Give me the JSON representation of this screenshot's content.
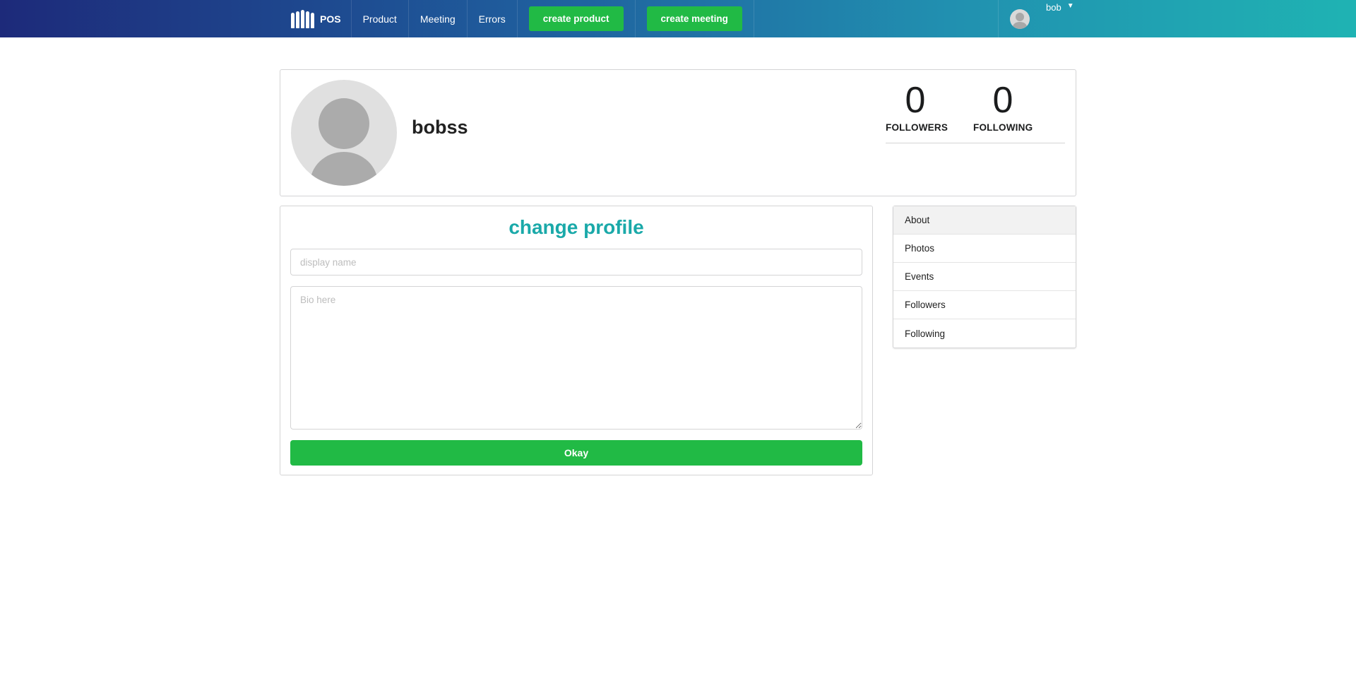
{
  "colors": {
    "accent_teal": "#1aa9a9",
    "button_green": "#21ba45",
    "nav_gradient_start": "#1d2a7a",
    "nav_gradient_end": "#1fb3b3"
  },
  "nav": {
    "brand": "POS",
    "brand_icon": "people-group-icon",
    "links": [
      "Product",
      "Meeting",
      "Errors"
    ],
    "create_product": "create product",
    "create_meeting": "create meeting",
    "user": {
      "name": "bob",
      "avatar_icon": "user-avatar-icon",
      "dropdown_icon": "caret-down-icon"
    }
  },
  "profile": {
    "name": "bobss",
    "avatar_icon": "user-avatar-icon",
    "followers": {
      "value": "0",
      "label": "FOLLOWERS"
    },
    "following": {
      "value": "0",
      "label": "FOLLOWING"
    }
  },
  "form": {
    "title": "change profile",
    "display_name_placeholder": "display name",
    "display_name_value": "",
    "bio_placeholder": "Bio here",
    "bio_value": "",
    "submit": "Okay"
  },
  "menu": {
    "active": "About",
    "items": [
      "About",
      "Photos",
      "Events",
      "Followers",
      "Following"
    ]
  }
}
